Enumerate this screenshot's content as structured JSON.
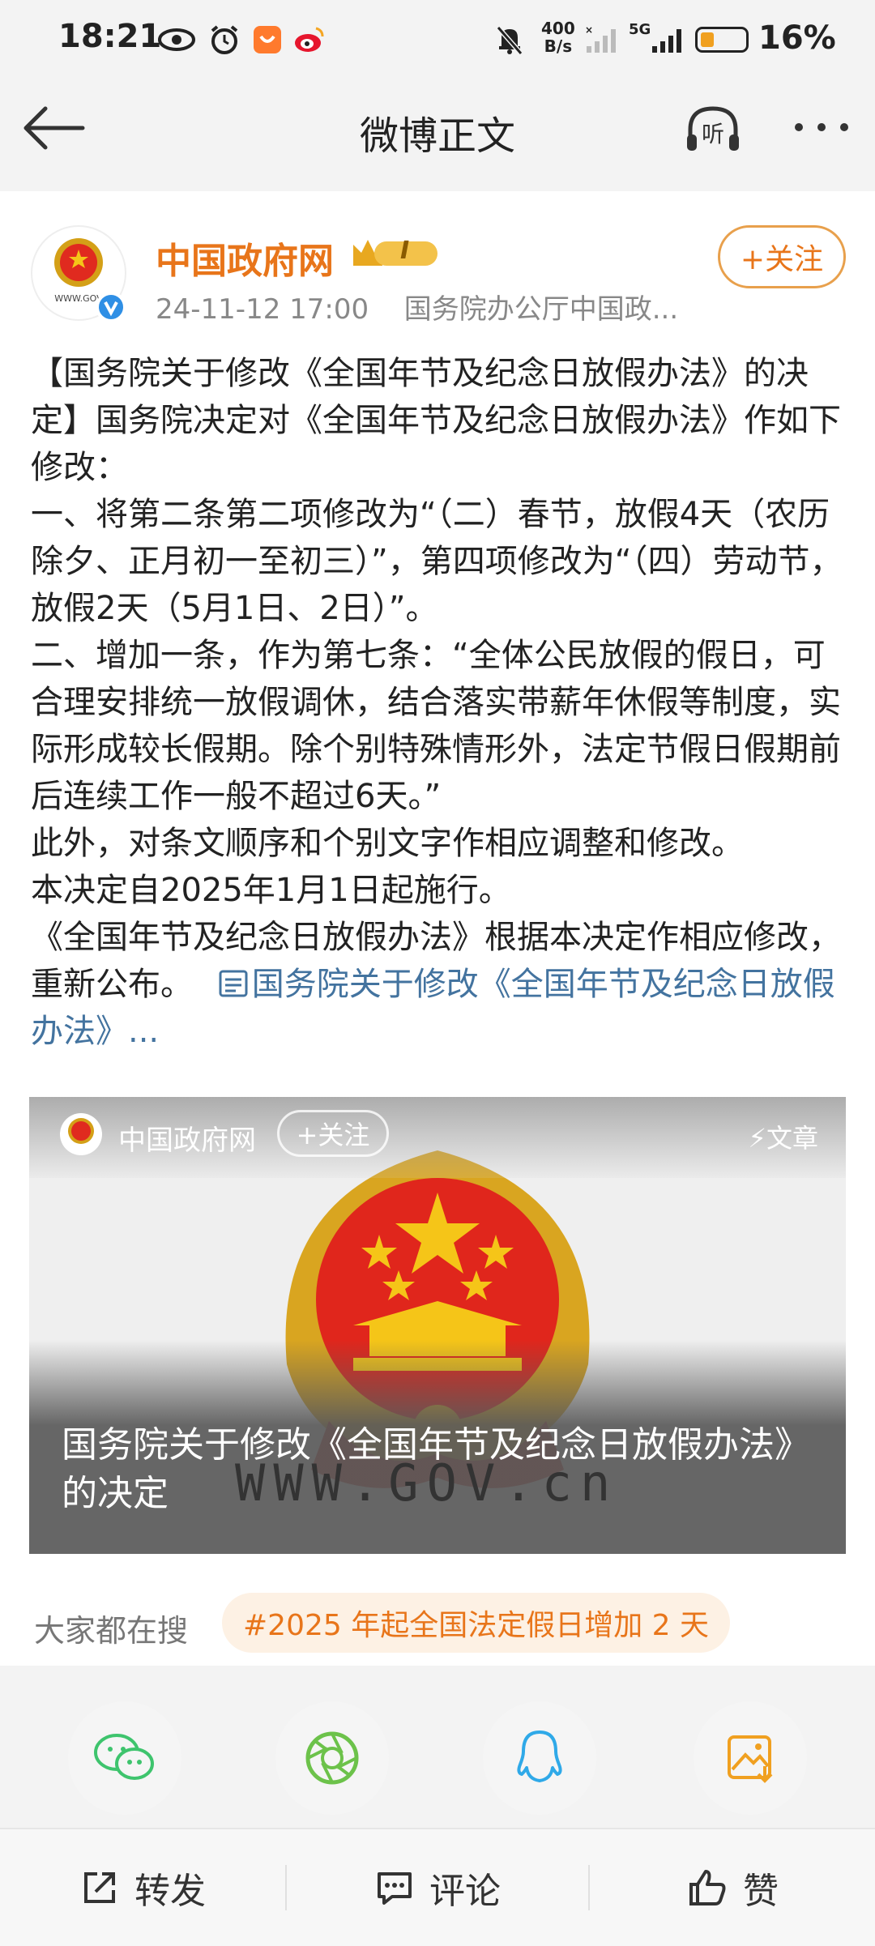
{
  "status_bar": {
    "time": "18:21",
    "net_speed_top": "400",
    "net_speed_bottom": "B/s",
    "network_type": "5G",
    "battery_percent": "16%",
    "battery_level": 0.16
  },
  "nav": {
    "title": "微博正文",
    "back_icon": "back-arrow-icon",
    "listen_label": "听",
    "more_icon": "more-dots-icon"
  },
  "post": {
    "author": "中国政府网",
    "level_badge": "I",
    "timestamp": "24-11-12 17:00",
    "source": "国务院办公厅中国政...",
    "follow_label": "+关注",
    "avatar_text": "WWW.GOV",
    "body": [
      "【国务院关于修改《全国年节及纪念日放假办法》的决定】国务院决定对《全国年节及纪念日放假办法》作如下修改：",
      "一、将第二条第二项修改为“（二）春节，放假4天（农历除夕、正月初一至初三）”，第四项修改为“（四）劳动节，放假2天（5月1日、2日）”。",
      "二、增加一条，作为第七条：“全体公民放假的假日，可合理安排统一放假调休，结合落实带薪年休假等制度，实际形成较长假期。除个别特殊情形外，法定节假日假期前后连续工作一般不超过6天。”",
      "此外，对条文顺序和个别文字作相应调整和修改。",
      "本决定自2025年1月1日起施行。"
    ],
    "body_last_prefix": "《全国年节及纪念日放假办法》根据本决定作相应修改，重新公布。",
    "link_text": "国务院关于修改《全国年节及纪念日放假办法》...",
    "accent_color": "#e8751a",
    "link_color": "#43739f"
  },
  "article_card": {
    "source_name": "中国政府网",
    "follow_label": "+关注",
    "type_label": "文章",
    "title": "国务院关于修改《全国年节及纪念日放假办法》的决定",
    "emblem_text": "WWW.GOV.cn"
  },
  "trending": {
    "label": "大家都在搜",
    "tag": "#2025 年起全国法定假日增加 2 天"
  },
  "share": [
    {
      "name": "wechat-icon"
    },
    {
      "name": "moments-icon"
    },
    {
      "name": "qq-icon"
    },
    {
      "name": "save-image-icon"
    }
  ],
  "bottom_bar": {
    "repost": "转发",
    "comment": "评论",
    "like": "赞"
  }
}
